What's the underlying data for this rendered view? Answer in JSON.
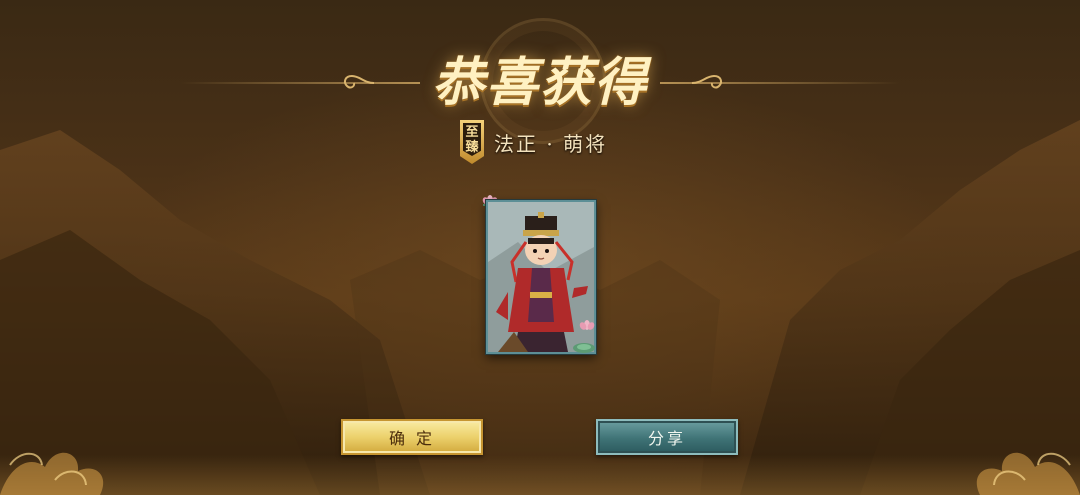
{
  "header": {
    "title": "恭喜获得"
  },
  "reward": {
    "quality_badge_top": "至",
    "quality_badge_bottom": "臻",
    "card_name": "法正 · 萌将"
  },
  "buttons": {
    "confirm_label": "确 定",
    "share_label": "分享"
  },
  "colors": {
    "title": "#fff1c2",
    "confirm_button": "#ecd16c",
    "share_button": "#3f7376",
    "card_border": "#5d8f96"
  },
  "icons": {
    "quality_badge": "quality-badge-icon",
    "card_art": "character-card-art",
    "lotus": "lotus-flower-icon"
  }
}
